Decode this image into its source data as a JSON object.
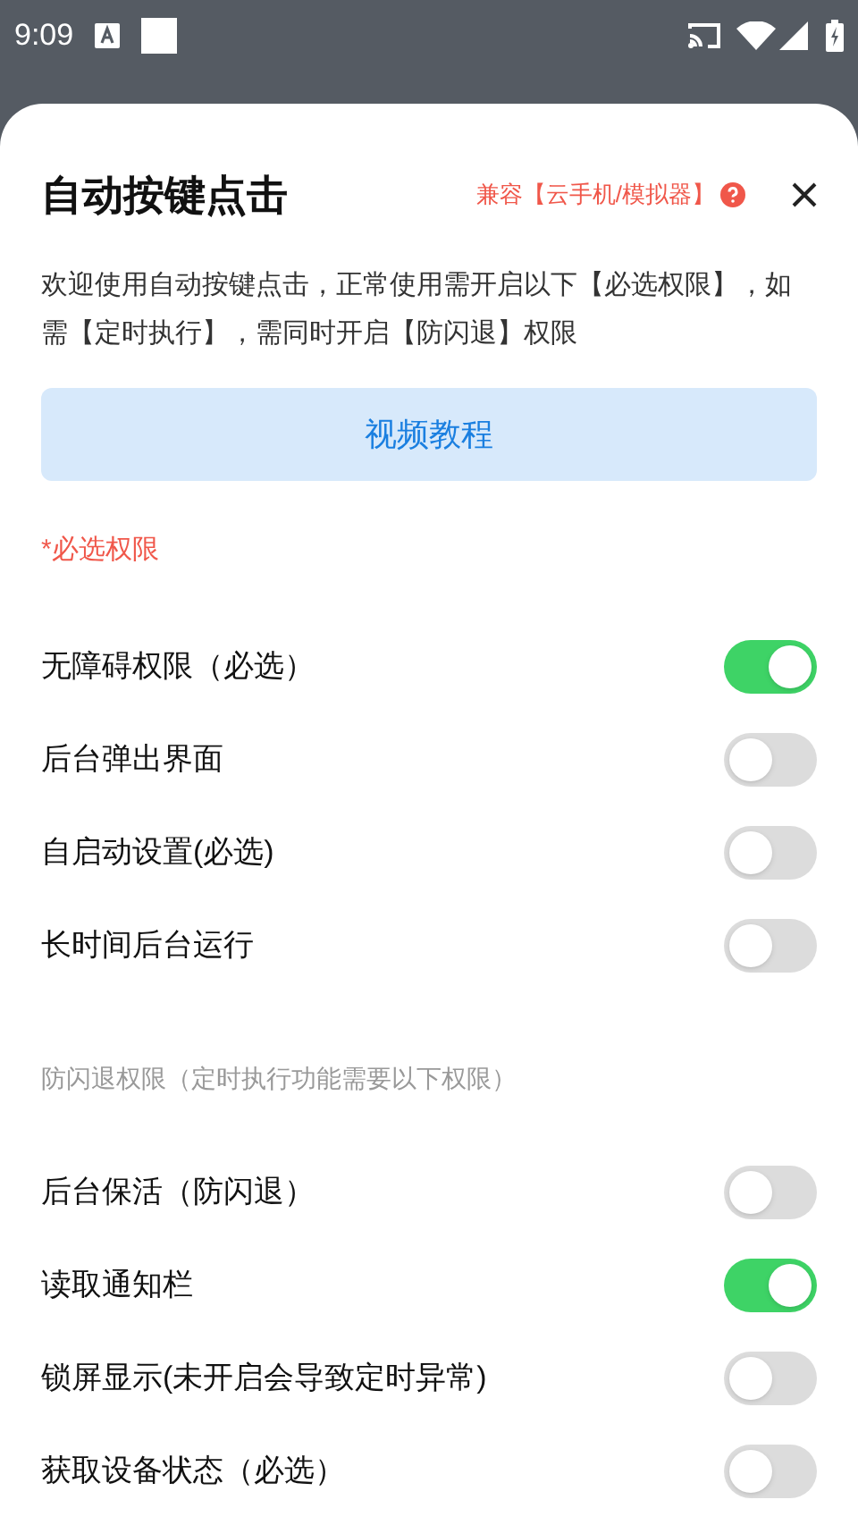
{
  "status_bar": {
    "time": "9:09"
  },
  "dialog": {
    "title": "自动按键点击",
    "compat_link": "兼容【云手机/模拟器】",
    "description": "欢迎使用自动按键点击，正常使用需开启以下【必选权限】，如需【定时执行】，需同时开启【防闪退】权限",
    "tutorial_button": "视频教程"
  },
  "sections": [
    {
      "label": "*必选权限",
      "kind": "required",
      "items": [
        {
          "label": "无障碍权限（必选）",
          "on": true
        },
        {
          "label": "后台弹出界面",
          "on": false
        },
        {
          "label": "自启动设置(必选)",
          "on": false
        },
        {
          "label": "长时间后台运行",
          "on": false
        }
      ]
    },
    {
      "label": "防闪退权限（定时执行功能需要以下权限）",
      "kind": "optional",
      "items": [
        {
          "label": "后台保活（防闪退）",
          "on": false
        },
        {
          "label": "读取通知栏",
          "on": true
        },
        {
          "label": "锁屏显示(未开启会导致定时异常)",
          "on": false
        },
        {
          "label": "获取设备状态（必选）",
          "on": false
        }
      ]
    }
  ]
}
